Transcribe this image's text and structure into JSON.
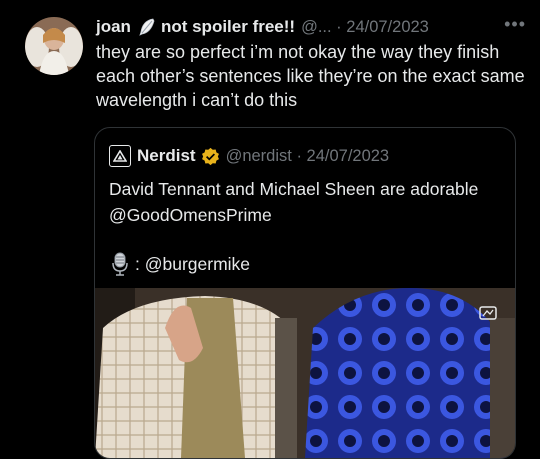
{
  "tweet": {
    "author_name": "joan",
    "name_suffix": "not spoiler free!!",
    "handle": "@...",
    "date": "24/07/2023",
    "text": "they are so perfect i’m not okay the way they finish each other’s sentences like they’re on the exact same wavelength i can’t do this",
    "more_icon": "more-icon",
    "avatar_icon": "angel-avatar",
    "name_emoji_icon": "feather-icon"
  },
  "quoted": {
    "author_name": "Nerdist",
    "handle": "@nerdist",
    "date": "24/07/2023",
    "text": "David Tennant and Michael Sheen are adorable @GoodOmensPrime",
    "credit_handle": "@burgermike",
    "credit_icon": "microphone-icon",
    "verified_color": "#e8b21b",
    "media_icon": "media-view-icon"
  },
  "colors": {
    "background": "#000000",
    "text": "#e7e9ea",
    "muted": "#71767b",
    "border": "#2f3336"
  }
}
